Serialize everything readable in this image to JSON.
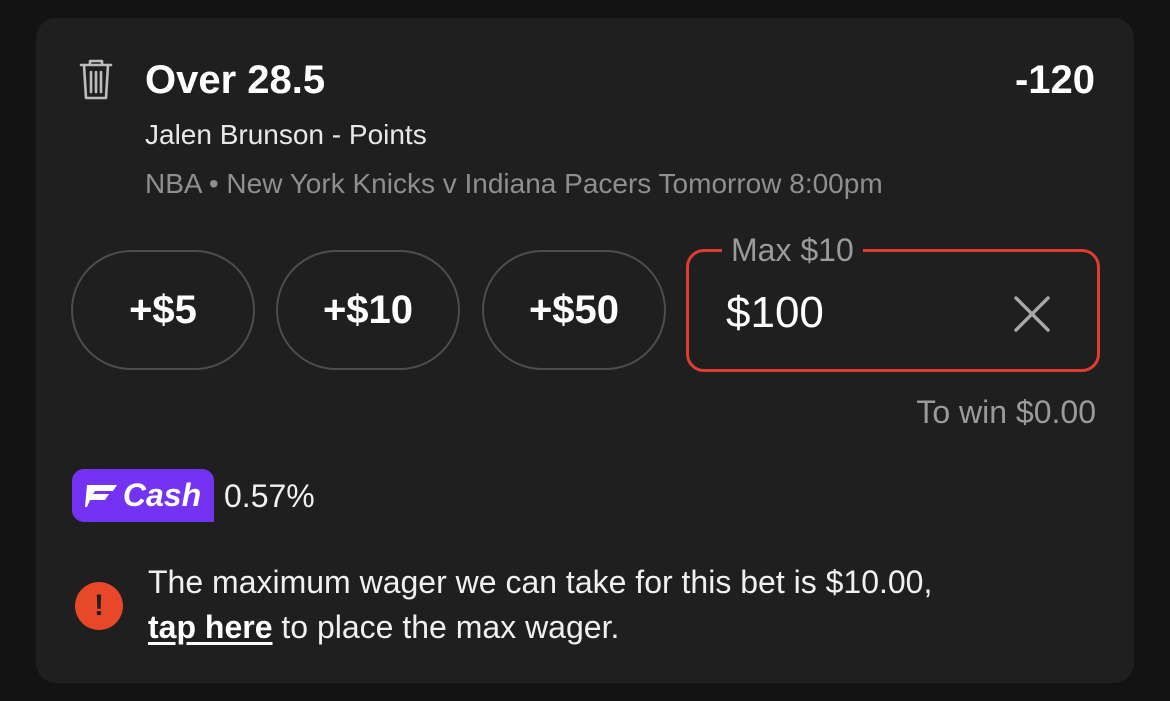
{
  "bet": {
    "selection": "Over 28.5",
    "odds": "-120",
    "market": "Jalen Brunson - Points",
    "league": "NBA",
    "separator": "•",
    "event": "New York Knicks v Indiana Pacers Tomorrow 8:00pm"
  },
  "quick_add": [
    {
      "label": "+$5"
    },
    {
      "label": "+$10"
    },
    {
      "label": "+$50"
    }
  ],
  "wager": {
    "legend": "Max $10",
    "value": "$100",
    "to_win": "To win $0.00",
    "clear_icon": "close-icon",
    "border_color": "#e03c2f"
  },
  "fcash": {
    "label": "Cash",
    "percent": "0.57%",
    "color": "#7433f2"
  },
  "warning": {
    "icon": "!",
    "text_before": "The maximum wager we can take for this bet is $10.00,",
    "link": "tap here",
    "text_after": "to place the max wager.",
    "color": "#e8472a"
  }
}
